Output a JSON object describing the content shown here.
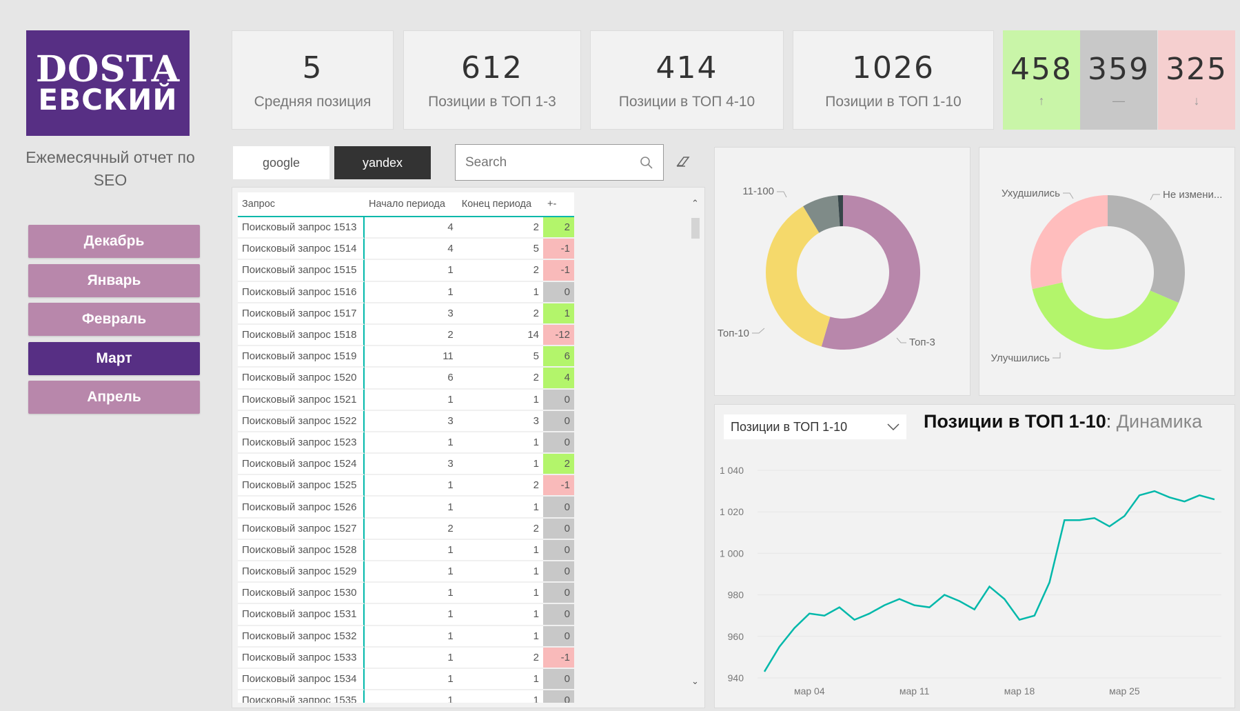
{
  "logo": {
    "line1": "DOSTA",
    "line2": "ЕВСКИЙ"
  },
  "subtitle": "Ежемесячный отчет по SEO",
  "months": [
    {
      "label": "Декабрь",
      "active": false
    },
    {
      "label": "Январь",
      "active": false
    },
    {
      "label": "Февраль",
      "active": false
    },
    {
      "label": "Март",
      "active": true
    },
    {
      "label": "Апрель",
      "active": false
    }
  ],
  "kpis": [
    {
      "value": "5",
      "label": "Средняя позиция"
    },
    {
      "value": "612",
      "label": "Позиции в ТОП 1-3"
    },
    {
      "value": "414",
      "label": "Позиции в ТОП 4-10"
    },
    {
      "value": "1026",
      "label": "Позиции в ТОП 1-10"
    }
  ],
  "changes": [
    {
      "value": "458",
      "arrow": "↑",
      "color": "#c9f5a8"
    },
    {
      "value": "359",
      "arrow": "—",
      "color": "#c8c8c8"
    },
    {
      "value": "325",
      "arrow": "↓",
      "color": "#f5cfcf"
    }
  ],
  "engine_tabs": [
    {
      "label": "google",
      "active": false
    },
    {
      "label": "yandex",
      "active": true
    }
  ],
  "search": {
    "placeholder": "Search",
    "value": ""
  },
  "table": {
    "columns": [
      "Запрос",
      "Начало периода",
      "Конец периода",
      "+-"
    ],
    "rows": [
      [
        "Поисковый запрос 1513",
        4,
        2,
        2
      ],
      [
        "Поисковый запрос 1514",
        4,
        5,
        -1
      ],
      [
        "Поисковый запрос 1515",
        1,
        2,
        -1
      ],
      [
        "Поисковый запрос 1516",
        1,
        1,
        0
      ],
      [
        "Поисковый запрос 1517",
        3,
        2,
        1
      ],
      [
        "Поисковый запрос 1518",
        2,
        14,
        -12
      ],
      [
        "Поисковый запрос 1519",
        11,
        5,
        6
      ],
      [
        "Поисковый запрос 1520",
        6,
        2,
        4
      ],
      [
        "Поисковый запрос 1521",
        1,
        1,
        0
      ],
      [
        "Поисковый запрос 1522",
        3,
        3,
        0
      ],
      [
        "Поисковый запрос 1523",
        1,
        1,
        0
      ],
      [
        "Поисковый запрос 1524",
        3,
        1,
        2
      ],
      [
        "Поисковый запрос 1525",
        1,
        2,
        -1
      ],
      [
        "Поисковый запрос 1526",
        1,
        1,
        0
      ],
      [
        "Поисковый запрос 1527",
        2,
        2,
        0
      ],
      [
        "Поисковый запрос 1528",
        1,
        1,
        0
      ],
      [
        "Поисковый запрос 1529",
        1,
        1,
        0
      ],
      [
        "Поисковый запрос 1530",
        1,
        1,
        0
      ],
      [
        "Поисковый запрос 1531",
        1,
        1,
        0
      ],
      [
        "Поисковый запрос 1532",
        1,
        1,
        0
      ],
      [
        "Поисковый запрос 1533",
        1,
        2,
        -1
      ],
      [
        "Поисковый запрос 1534",
        1,
        1,
        0
      ],
      [
        "Поисковый запрос 1535",
        1,
        1,
        0
      ]
    ],
    "colors": {
      "positive": "#b3f56b",
      "negative": "#f9baba",
      "zero": "#c8c8c8",
      "accent": "#01b8aa"
    }
  },
  "chart_data": [
    {
      "type": "pie",
      "variant": "donut",
      "slices": [
        {
          "label": "Топ-3",
          "value": 612,
          "color": "#b887ab"
        },
        {
          "label": "Топ-10",
          "value": 414,
          "color": "#f5d96b"
        },
        {
          "label": "11-100",
          "value": 85,
          "color": "#7f8b88"
        },
        {
          "label": "",
          "value": 12,
          "color": "#374649"
        }
      ]
    },
    {
      "type": "pie",
      "variant": "donut",
      "slices": [
        {
          "label": "Не измени...",
          "value": 359,
          "color": "#b3b3b3"
        },
        {
          "label": "Улучшились",
          "value": 458,
          "color": "#b3f56b"
        },
        {
          "label": "Ухудшились",
          "value": 325,
          "color": "#ffbdbd"
        }
      ]
    },
    {
      "type": "line",
      "title_main": "Позиции в ТОП 1-10",
      "title_sep": ": ",
      "title_sub": "Динамика",
      "selector": "Позиции в ТОП 1-10",
      "color": "#01b8aa",
      "ylim": [
        938,
        1045
      ],
      "grid": true,
      "yticks": [
        "940",
        "960",
        "980",
        "1 000",
        "1 020",
        "1 040"
      ],
      "ytick_values": [
        940,
        960,
        980,
        1000,
        1020,
        1040
      ],
      "xticks": [
        {
          "label": "мар 04",
          "day": 4
        },
        {
          "label": "мар 11",
          "day": 11
        },
        {
          "label": "мар 18",
          "day": 18
        },
        {
          "label": "мар 25",
          "day": 25
        }
      ],
      "x_days": [
        1,
        2,
        3,
        4,
        5,
        6,
        7,
        8,
        9,
        10,
        11,
        12,
        13,
        14,
        15,
        16,
        17,
        18,
        19,
        20,
        21,
        22,
        23,
        24,
        25,
        26,
        27,
        28,
        29,
        30,
        31
      ],
      "values": [
        943,
        955,
        964,
        971,
        970,
        974,
        968,
        971,
        975,
        978,
        975,
        974,
        980,
        977,
        973,
        984,
        978,
        968,
        970,
        986,
        1016,
        1016,
        1017,
        1013,
        1018,
        1028,
        1030,
        1027,
        1025,
        1028,
        1026
      ]
    }
  ]
}
